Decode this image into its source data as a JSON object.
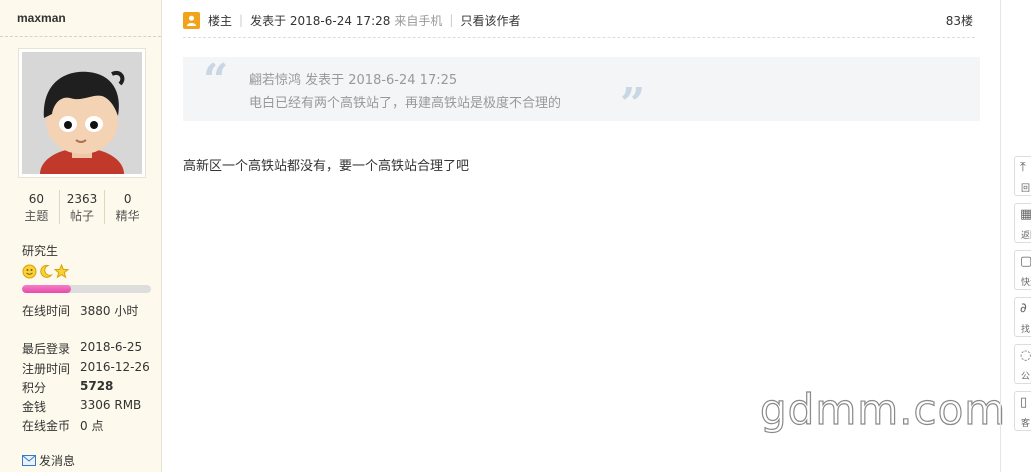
{
  "author": {
    "username": "maxman",
    "stats": [
      {
        "value": "60",
        "label": "主题"
      },
      {
        "value": "2363",
        "label": "帖子"
      },
      {
        "value": "0",
        "label": "精华"
      }
    ],
    "rank": "研究生",
    "rank_progress": 0.38,
    "online_time": {
      "label": "在线时间",
      "value": "3880 小时"
    },
    "last_login": {
      "label": "最后登录",
      "value": "2018-6-25"
    },
    "register_time": {
      "label": "注册时间",
      "value": "2016-12-26"
    },
    "points": {
      "label": "积分",
      "value": "5728"
    },
    "money": {
      "label": "金钱",
      "value": "3306 RMB"
    },
    "online_coins": {
      "label": "在线金币",
      "value": "0 点"
    },
    "send_message": "发消息"
  },
  "post": {
    "owner_label": "楼主",
    "posted_at": "发表于 2018-6-24 17:28",
    "source": "来自手机",
    "only_author": "只看该作者",
    "floor": "83楼",
    "quote": {
      "line1": "翩若惊鸿 发表于 2018-6-24 17:25",
      "line2": "电白已经有两个高铁站了，再建高铁站是极度不合理的"
    },
    "content": "高新区一个高铁站都没有，要一个高铁站合理了吧"
  },
  "watermark": "gdmm.com",
  "float_buttons": [
    {
      "icon": "arrow-up-icon",
      "label": "回"
    },
    {
      "icon": "grid-icon",
      "label": "返回"
    },
    {
      "icon": "chat-bubble-icon",
      "label": "快速"
    },
    {
      "icon": "link-icon",
      "label": "找"
    },
    {
      "icon": "speech-icon",
      "label": "公"
    },
    {
      "icon": "document-icon",
      "label": "客"
    }
  ],
  "colors": {
    "accent": "#f0a31b",
    "progress": "#e54aa8",
    "quote_bg": "#f3f5f7"
  }
}
